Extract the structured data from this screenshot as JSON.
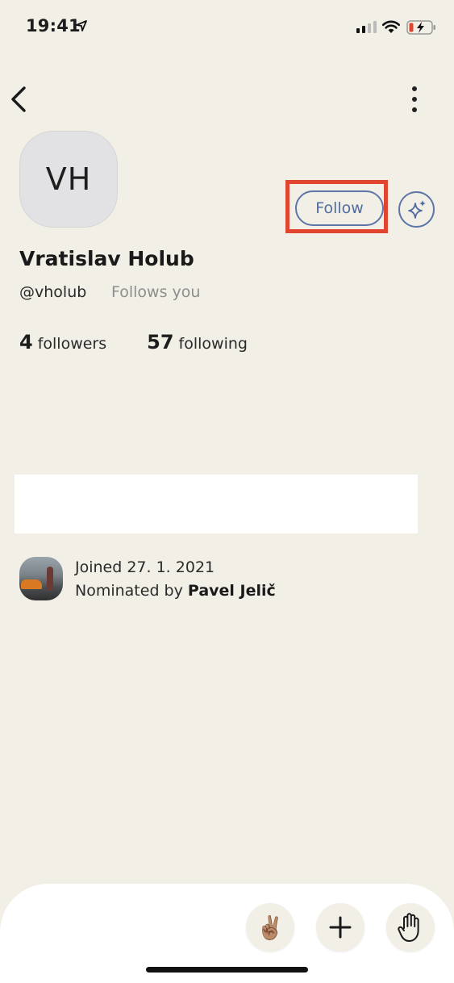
{
  "status_bar": {
    "time": "19:41"
  },
  "profile": {
    "avatar_initials": "VH",
    "display_name": "Vratislav Holub",
    "handle": "@vholub",
    "follows_you": "Follows you",
    "followers_count": "4",
    "followers_label": "followers",
    "following_count": "57",
    "following_label": "following",
    "follow_button_label": "Follow"
  },
  "joined": {
    "joined_text": "Joined 27. 1. 2021",
    "nominated_prefix": "Nominated by",
    "nominator_name": "Pavel Jelič"
  },
  "bottom_bar": {
    "victory_emoji": "✌🏽"
  },
  "colors": {
    "background": "#f1efe6",
    "accent": "#5d76a7",
    "highlight": "#e2452f"
  }
}
